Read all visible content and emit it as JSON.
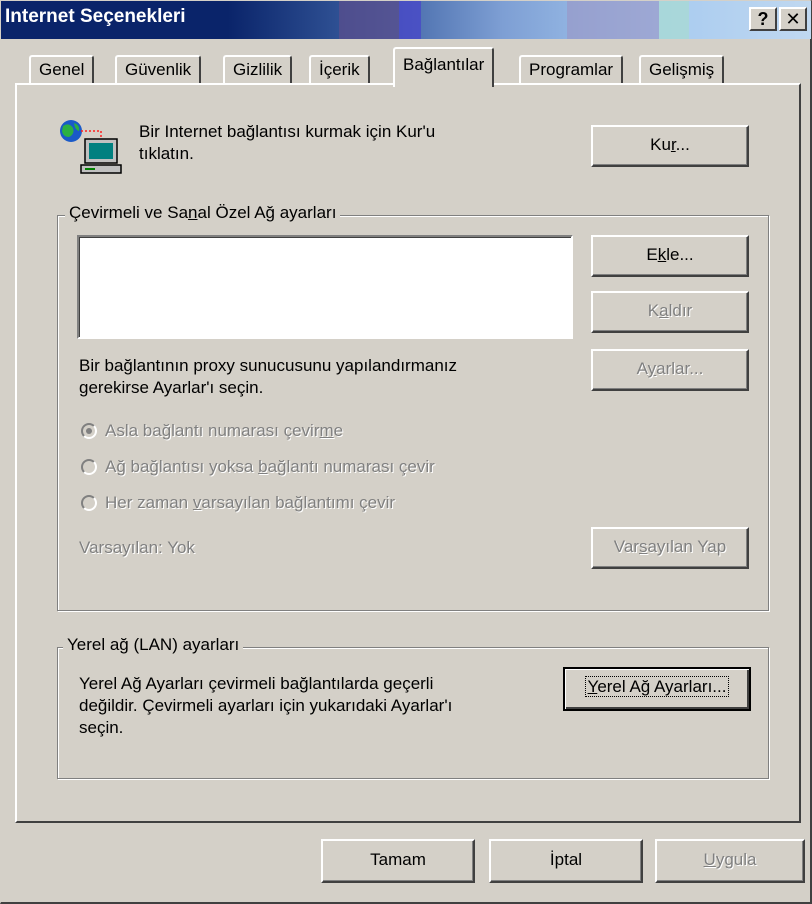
{
  "window": {
    "title": "Internet Seçenekleri",
    "help_button": "?",
    "close_button": "✕"
  },
  "tabs": [
    {
      "label": "Genel",
      "active": false
    },
    {
      "label": "Güvenlik",
      "active": false
    },
    {
      "label": "Gizlilik",
      "active": false
    },
    {
      "label": "İçerik",
      "active": false
    },
    {
      "label": "Bağlantılar",
      "active": true
    },
    {
      "label": "Programlar",
      "active": false
    },
    {
      "label": "Gelişmiş",
      "active": false
    }
  ],
  "setup": {
    "icon": "network-computer-icon",
    "text_line1": "Bir Internet bağlantısı kurmak için Kur'u",
    "text_line2": "tıklatın.",
    "button_pre": "Ku",
    "button_mnemonic": "r",
    "button_post": "..."
  },
  "dialup": {
    "group_pre": "Çevirmeli ve Sa",
    "group_mnemonic": "n",
    "group_post": "al Özel Ağ ayarları",
    "add_pre": "E",
    "add_mnemonic": "k",
    "add_post": "le...",
    "remove_pre": "K",
    "remove_mnemonic": "a",
    "remove_post": "ldır",
    "settings_pre": "A",
    "settings_mnemonic": "y",
    "settings_post": "arlar...",
    "proxy_line1": "Bir bağlantının proxy sunucusunu yapılandırmanız",
    "proxy_line2": "gerekirse Ayarlar'ı seçin.",
    "radio1_pre": "Asla bağlantı numarası çevir",
    "radio1_mnemonic": "m",
    "radio1_post": "e",
    "radio2_pre": "Ağ bağlantısı yoksa ",
    "radio2_mnemonic": "b",
    "radio2_post": "ağlantı numarası çevir",
    "radio3_pre": "Her zaman ",
    "radio3_mnemonic": "v",
    "radio3_post": "arsayılan bağlantımı çevir",
    "default_label": "Varsayılan:  Yok",
    "set_default_pre": "Var",
    "set_default_mnemonic": "s",
    "set_default_post": "ayılan Yap"
  },
  "lan": {
    "group_label": "Yerel ağ (LAN) ayarları",
    "text_line1": "Yerel Ağ Ayarları çevirmeli bağlantılarda geçerli",
    "text_line2": "değildir. Çevirmeli ayarları için yukarıdaki Ayarlar'ı",
    "text_line3": "seçin.",
    "button_pre": "",
    "button_mnemonic": "Y",
    "button_post": "erel Ağ Ayarları..."
  },
  "footer": {
    "ok": "Tamam",
    "cancel": "İptal",
    "apply_mnemonic": "U",
    "apply_post": "ygula"
  },
  "colors": {
    "face": "#d4d0c8",
    "title_start": "#0a246a",
    "title_end": "#a6caf0"
  }
}
